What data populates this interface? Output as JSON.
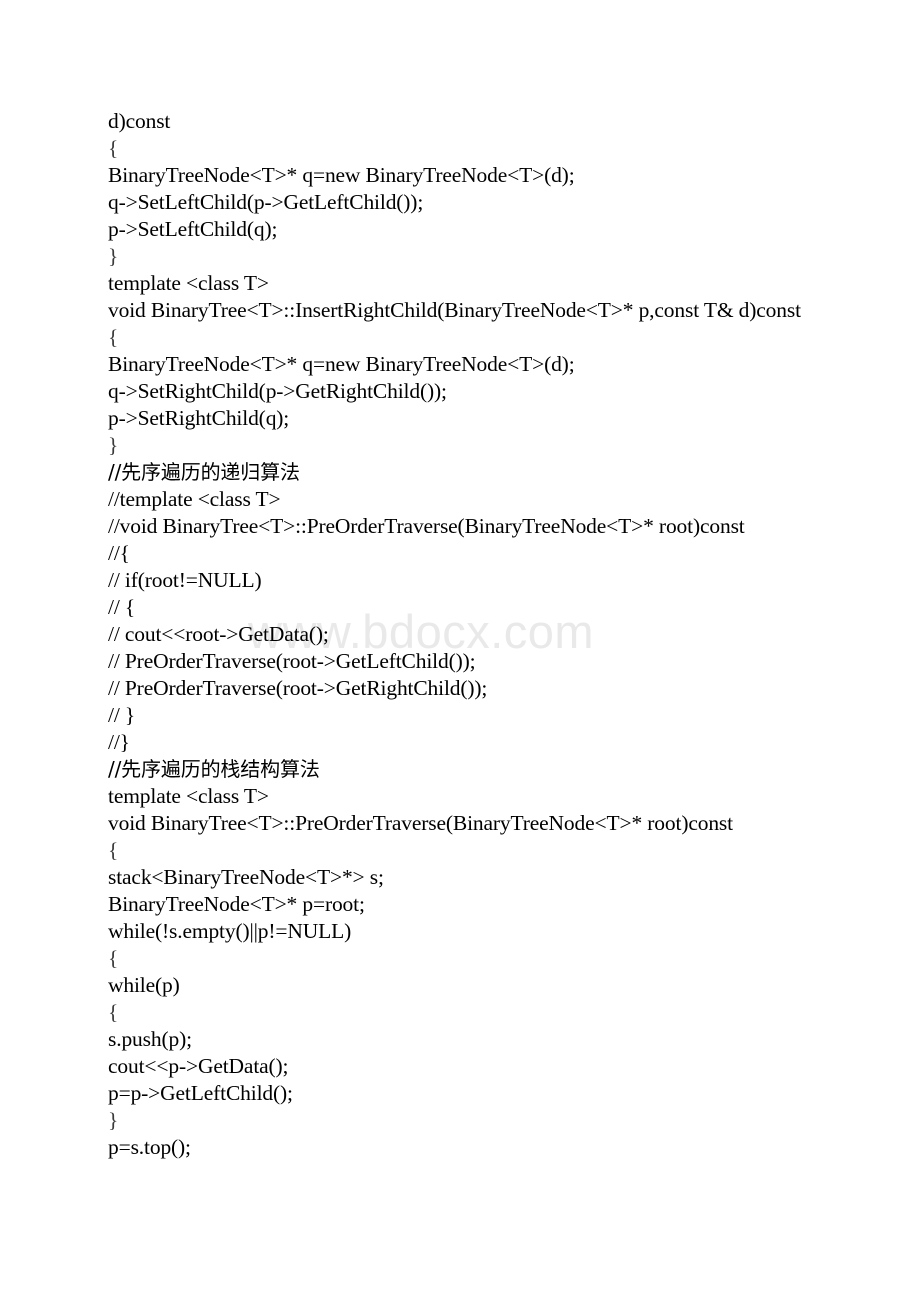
{
  "document": {
    "title": "Binary Tree C++ Source Listing",
    "watermark": "www.bdocx.com",
    "watermark_color": "#e9e9e9",
    "text_color": "#000000",
    "background_color": "#ffffff",
    "language": "C++",
    "lines": [
      {
        "text": "d)const"
      },
      {
        "text": "{"
      },
      {
        "text": "BinaryTreeNode<T>* q=new BinaryTreeNode<T>(d);"
      },
      {
        "text": "q->SetLeftChild(p->GetLeftChild());"
      },
      {
        "text": "p->SetLeftChild(q);"
      },
      {
        "text": "}"
      },
      {
        "text": "template <class T>"
      },
      {
        "text": "void BinaryTree<T>::InsertRightChild(BinaryTreeNode<T>* p,const T& d)const"
      },
      {
        "text": "{"
      },
      {
        "text": "BinaryTreeNode<T>* q=new BinaryTreeNode<T>(d);"
      },
      {
        "text": "q->SetRightChild(p->GetRightChild());"
      },
      {
        "text": "p->SetRightChild(q);"
      },
      {
        "text": "}"
      },
      {
        "text": "//先序遍历的递归算法"
      },
      {
        "text": "//template <class T>"
      },
      {
        "text": "//void BinaryTree<T>::PreOrderTraverse(BinaryTreeNode<T>* root)const"
      },
      {
        "text": "//{"
      },
      {
        "text": "// if(root!=NULL)"
      },
      {
        "text": "// {"
      },
      {
        "text": "// cout<<root->GetData();"
      },
      {
        "text": "// PreOrderTraverse(root->GetLeftChild());"
      },
      {
        "text": "// PreOrderTraverse(root->GetRightChild());"
      },
      {
        "text": "// }"
      },
      {
        "text": "//}"
      },
      {
        "text": "//先序遍历的栈结构算法"
      },
      {
        "text": "template <class T>"
      },
      {
        "text": "void BinaryTree<T>::PreOrderTraverse(BinaryTreeNode<T>* root)const"
      },
      {
        "text": "{"
      },
      {
        "text": "stack<BinaryTreeNode<T>*> s;"
      },
      {
        "text": "BinaryTreeNode<T>* p=root;"
      },
      {
        "text": "while(!s.empty()||p!=NULL)"
      },
      {
        "text": "{"
      },
      {
        "text": "while(p)"
      },
      {
        "text": "{"
      },
      {
        "text": "s.push(p);"
      },
      {
        "text": "cout<<p->GetData();"
      },
      {
        "text": "p=p->GetLeftChild();"
      },
      {
        "text": "}"
      },
      {
        "text": "p=s.top();"
      }
    ]
  }
}
